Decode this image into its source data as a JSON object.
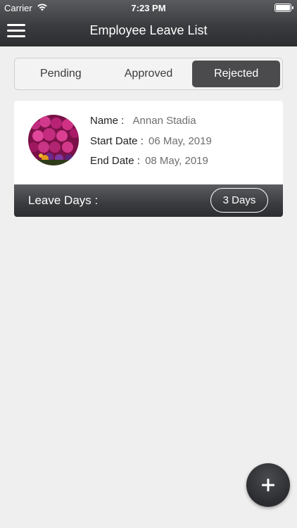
{
  "status_bar": {
    "carrier": "Carrier",
    "time": "7:23 PM",
    "wifi_icon": "wifi-icon",
    "battery_icon": "battery-icon"
  },
  "nav": {
    "title": "Employee Leave List",
    "menu_icon": "hamburger-menu-icon"
  },
  "tabs": [
    {
      "label": "Pending",
      "active": false
    },
    {
      "label": "Approved",
      "active": false
    },
    {
      "label": "Rejected",
      "active": true
    }
  ],
  "leave_card": {
    "avatar_icon": "flower-photo-avatar",
    "name_label": "Name :",
    "name_value": "Annan Stadia",
    "start_label": "Start Date :",
    "start_value": "06 May, 2019",
    "end_label": "End Date :",
    "end_value": "08 May, 2019",
    "leave_days_label": "Leave Days :",
    "leave_days_value": "3 Days"
  },
  "fab": {
    "icon": "plus-icon"
  },
  "colors": {
    "bar_dark": "#3b3c3f",
    "segment_active": "#4b4b4e",
    "background": "#efefef"
  }
}
